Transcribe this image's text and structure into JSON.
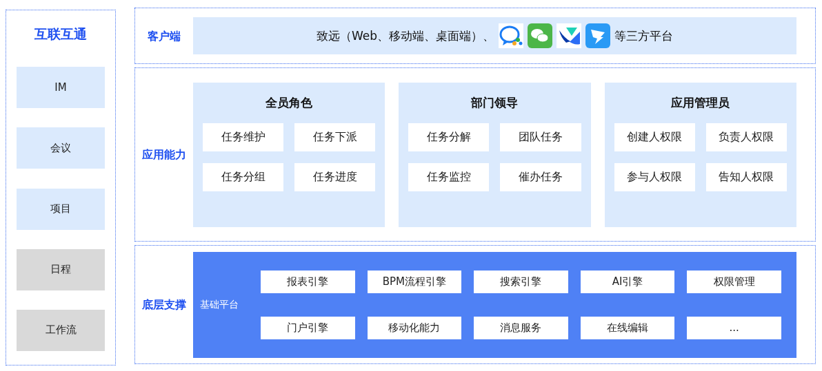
{
  "sidebar": {
    "title": "互联互通",
    "items": [
      {
        "label": "IM",
        "color": "#dbeafd"
      },
      {
        "label": "会议",
        "color": "#dbeafd"
      },
      {
        "label": "项目",
        "color": "#dbeafd"
      },
      {
        "label": "日程",
        "color": "#d9d9d9"
      },
      {
        "label": "工作流",
        "color": "#d9d9d9"
      }
    ]
  },
  "client": {
    "label": "客户端",
    "text_before": "致远（Web、移动端、桌面端）、",
    "platform_icons": [
      {
        "kind": "chat"
      },
      {
        "kind": "bubbles"
      },
      {
        "kind": "wing"
      },
      {
        "kind": "bolt"
      }
    ],
    "text_after": "等三方平台"
  },
  "app": {
    "label": "应用能力",
    "groups": [
      {
        "title": "全员角色",
        "items": [
          "任务维护",
          "任务下派",
          "任务分组",
          "任务进度"
        ]
      },
      {
        "title": "部门领导",
        "items": [
          "任务分解",
          "团队任务",
          "任务监控",
          "催办任务"
        ]
      },
      {
        "title": "应用管理员",
        "items": [
          "创建人权限",
          "负责人权限",
          "参与人权限",
          "告知人权限"
        ]
      }
    ]
  },
  "base": {
    "label": "底层支撑",
    "platform": "基础平台",
    "items": [
      "报表引擎",
      "BPM流程引擎",
      "搜索引擎",
      "AI引擎",
      "权限管理",
      "门户引擎",
      "移动化能力",
      "消息服务",
      "在线编辑",
      "..."
    ]
  }
}
